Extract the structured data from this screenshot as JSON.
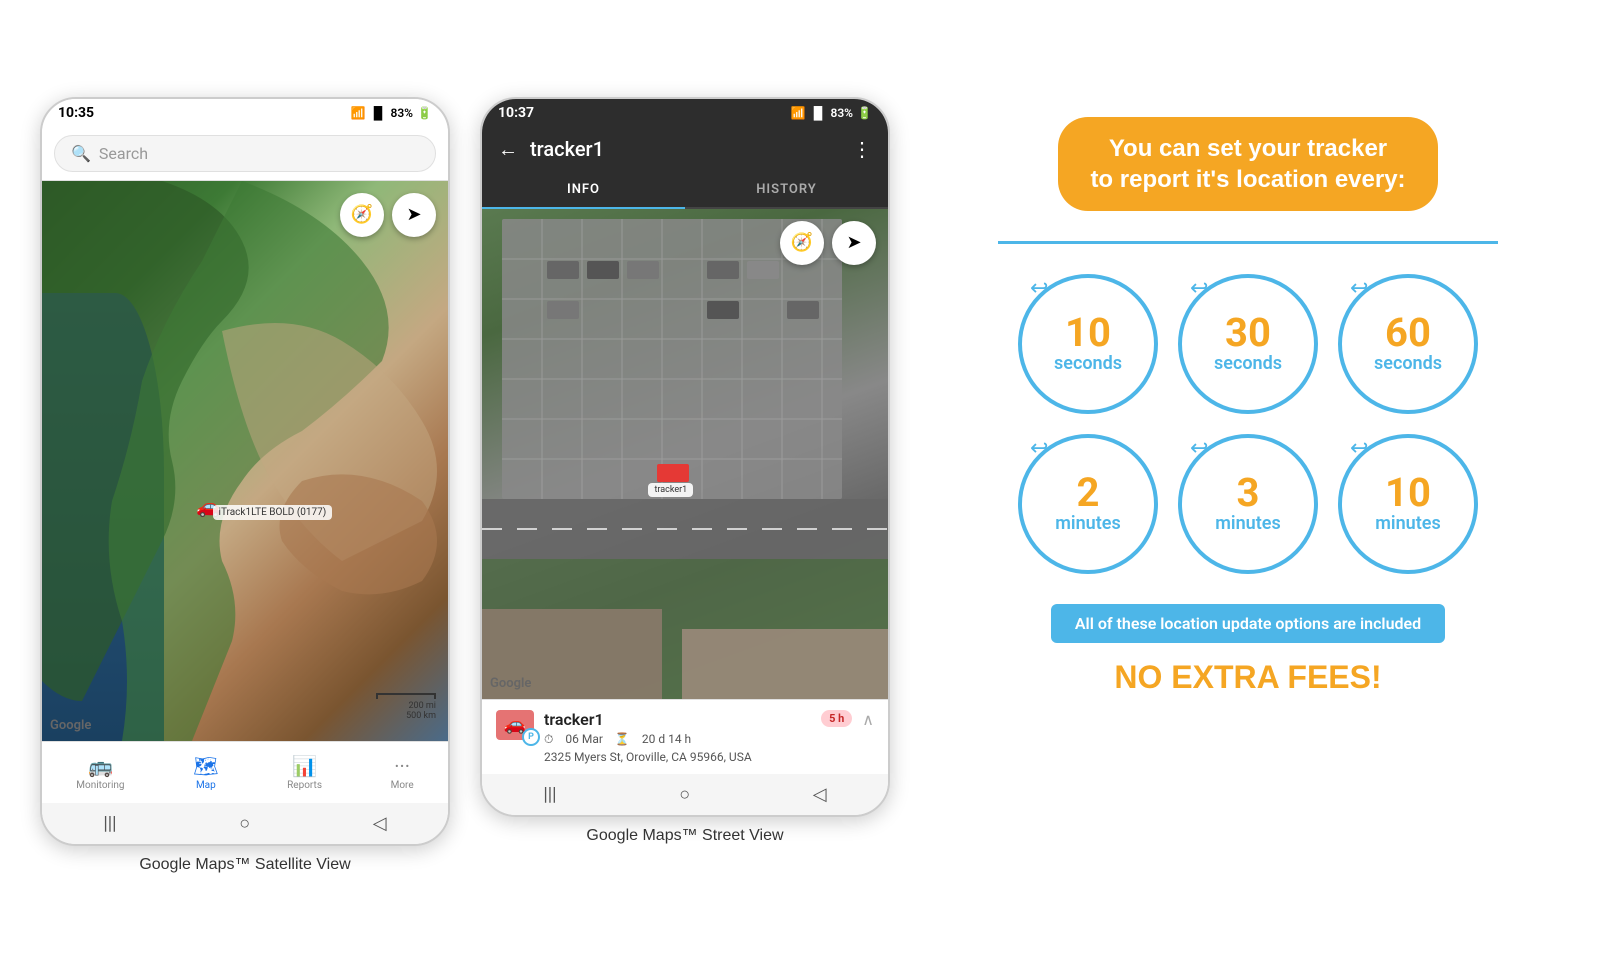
{
  "phone1": {
    "status": {
      "time": "10:35",
      "battery": "83%"
    },
    "search": {
      "placeholder": "Search"
    },
    "map": {
      "tracker_label": "iTrack1LTE BOLD (0177)",
      "google_watermark": "Google",
      "scale_200mi": "200 mi",
      "scale_500km": "500 km"
    },
    "nav": {
      "items": [
        {
          "label": "Monitoring",
          "icon": "🚌",
          "active": false
        },
        {
          "label": "Map",
          "icon": "🗺",
          "active": true
        },
        {
          "label": "Reports",
          "icon": "📊",
          "active": false
        },
        {
          "label": "More",
          "icon": "···",
          "active": false
        }
      ]
    },
    "caption": "Google Maps™ Satellite View"
  },
  "phone2": {
    "status": {
      "time": "10:37",
      "battery": "83%"
    },
    "header": {
      "title": "tracker1",
      "back_label": "←",
      "more_label": "⋮"
    },
    "tabs": [
      {
        "label": "INFO",
        "active": true
      },
      {
        "label": "HISTORY",
        "active": false
      }
    ],
    "map": {
      "google_watermark": "Google",
      "tracker_label": "tracker1"
    },
    "tracker_info": {
      "name": "tracker1",
      "date": "06 Mar",
      "duration": "20 d 14 h",
      "address": "2325 Myers St, Oroville, CA 95966, USA",
      "time_badge": "5 h"
    },
    "caption": "Google Maps™ Street View"
  },
  "info_panel": {
    "title_line1": "You can set your tracker",
    "title_line2": "to report it's location every:",
    "divider_color": "#4db6e8",
    "circles": [
      {
        "number": "10",
        "unit": "seconds"
      },
      {
        "number": "30",
        "unit": "seconds"
      },
      {
        "number": "60",
        "unit": "seconds"
      },
      {
        "number": "2",
        "unit": "minutes"
      },
      {
        "number": "3",
        "unit": "minutes"
      },
      {
        "number": "10",
        "unit": "minutes"
      }
    ],
    "included_text": "All of these location update options are included",
    "no_fees_text": "NO EXTRA FEES!",
    "accent_color": "#f5a623",
    "blue_color": "#4db6e8"
  }
}
